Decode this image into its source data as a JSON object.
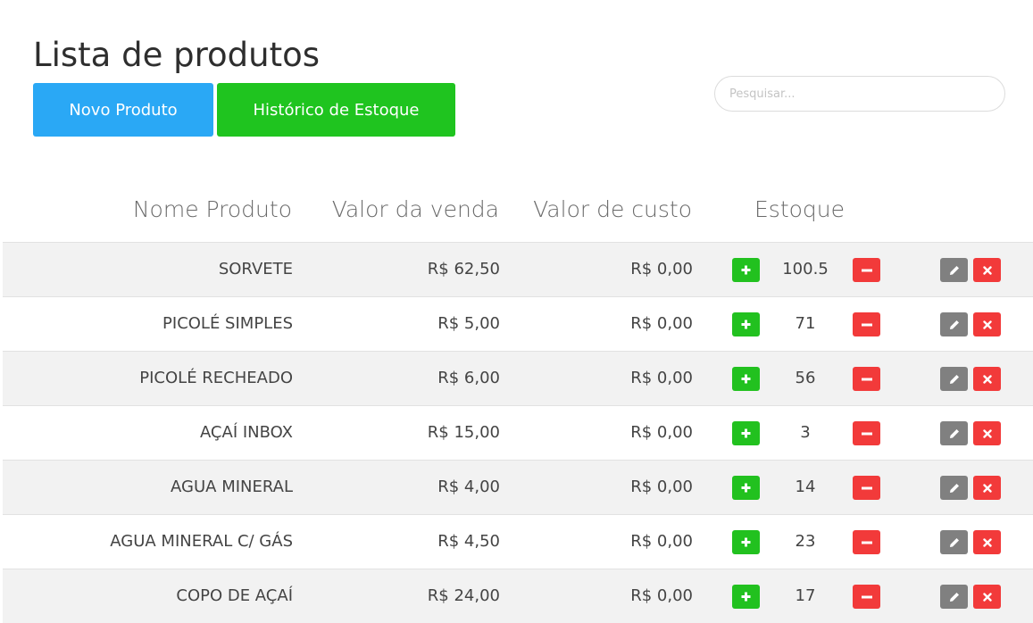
{
  "header": {
    "title": "Lista de produtos",
    "new_product_label": "Novo Produto",
    "stock_history_label": "Histórico de Estoque"
  },
  "search": {
    "placeholder": "Pesquisar..."
  },
  "colors": {
    "new_button": "#2aa8f5",
    "history_button": "#1fc41f",
    "add_button": "#22c11f",
    "remove_button": "#f23a3a",
    "edit_button": "#808080"
  },
  "table": {
    "columns": [
      "Nome Produto",
      "Valor da venda",
      "Valor de custo",
      "Estoque"
    ],
    "rows": [
      {
        "name": "SORVETE",
        "sale": "R$ 62,50",
        "cost": "R$ 0,00",
        "stock": "100.5"
      },
      {
        "name": "PICOLÉ SIMPLES",
        "sale": "R$ 5,00",
        "cost": "R$ 0,00",
        "stock": "71"
      },
      {
        "name": "PICOLÉ RECHEADO",
        "sale": "R$ 6,00",
        "cost": "R$ 0,00",
        "stock": "56"
      },
      {
        "name": "AÇAÍ INBOX",
        "sale": "R$ 15,00",
        "cost": "R$ 0,00",
        "stock": "3"
      },
      {
        "name": "AGUA MINERAL",
        "sale": "R$ 4,00",
        "cost": "R$ 0,00",
        "stock": "14"
      },
      {
        "name": "AGUA MINERAL C/ GÁS",
        "sale": "R$ 4,50",
        "cost": "R$ 0,00",
        "stock": "23"
      },
      {
        "name": "COPO DE AÇAÍ",
        "sale": "R$ 24,00",
        "cost": "R$ 0,00",
        "stock": "17"
      }
    ]
  }
}
